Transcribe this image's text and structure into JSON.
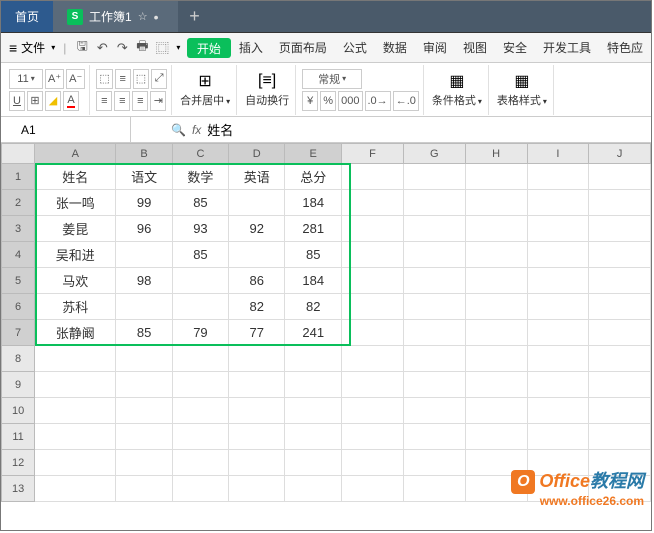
{
  "tabs": {
    "home": "首页",
    "workbook": "工作簿1",
    "add": "+"
  },
  "file_menu": "文件",
  "menu": {
    "start": "开始",
    "insert": "插入",
    "pagelayout": "页面布局",
    "formula": "公式",
    "data": "数据",
    "review": "审阅",
    "view": "视图",
    "security": "安全",
    "dev": "开发工具",
    "special": "特色应"
  },
  "ribbon": {
    "font_size": "11",
    "merge": "合并居中",
    "wrap": "自动换行",
    "numfmt": "常规",
    "condfmt": "条件格式",
    "tablestyle": "表格样式"
  },
  "namebox": "A1",
  "formula": "姓名",
  "columns": [
    "A",
    "B",
    "C",
    "D",
    "E",
    "F",
    "G",
    "H",
    "I",
    "J"
  ],
  "rows": [
    "1",
    "2",
    "3",
    "4",
    "5",
    "6",
    "7",
    "8",
    "9",
    "10",
    "11",
    "12",
    "13"
  ],
  "chart_data": {
    "type": "table",
    "headers": [
      "姓名",
      "语文",
      "数学",
      "英语",
      "总分"
    ],
    "data": [
      [
        "张一鸣",
        "99",
        "85",
        "",
        "184"
      ],
      [
        "姜昆",
        "96",
        "93",
        "92",
        "281"
      ],
      [
        "吴和进",
        "",
        "85",
        "",
        "85"
      ],
      [
        "马欢",
        "98",
        "",
        "86",
        "184"
      ],
      [
        "苏科",
        "",
        "",
        "82",
        "82"
      ],
      [
        "张静阚",
        "85",
        "79",
        "77",
        "241"
      ]
    ]
  },
  "watermark": {
    "brand1": "Office",
    "brand2": "教程网",
    "url": "www.office26.com"
  }
}
